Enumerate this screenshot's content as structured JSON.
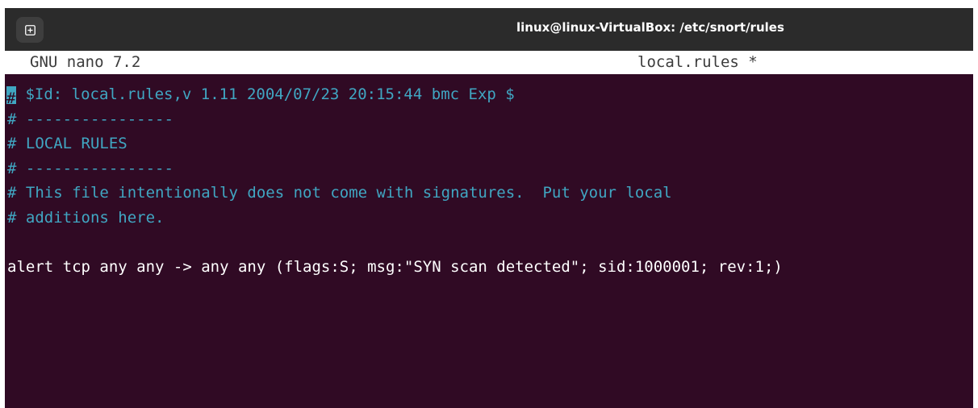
{
  "window": {
    "title": "linux@linux-VirtualBox: /etc/snort/rules",
    "new_tab_icon": "terminal-plus-icon"
  },
  "nano": {
    "version_label": "GNU nano 7.2",
    "file_label": "local.rules *"
  },
  "editor": {
    "lines": [
      {
        "text": " $Id: local.rules,v 1.11 2004/07/23 20:15:44 bmc Exp $",
        "type": "comment",
        "cursor_char": "#"
      },
      {
        "text": "# ----------------",
        "type": "comment"
      },
      {
        "text": "# LOCAL RULES",
        "type": "comment"
      },
      {
        "text": "# ----------------",
        "type": "comment"
      },
      {
        "text": "# This file intentionally does not come with signatures.  Put your local",
        "type": "comment"
      },
      {
        "text": "# additions here.",
        "type": "comment"
      },
      {
        "text": "",
        "type": "code"
      },
      {
        "text": "alert tcp any any -> any any (flags:S; msg:\"SYN scan detected\"; sid:1000001; rev:1;)",
        "type": "code"
      }
    ]
  },
  "colors": {
    "terminal_bg": "#300a24",
    "titlebar_bg": "#2b2b2b",
    "comment": "#40a6c2",
    "text": "#ffffff"
  }
}
